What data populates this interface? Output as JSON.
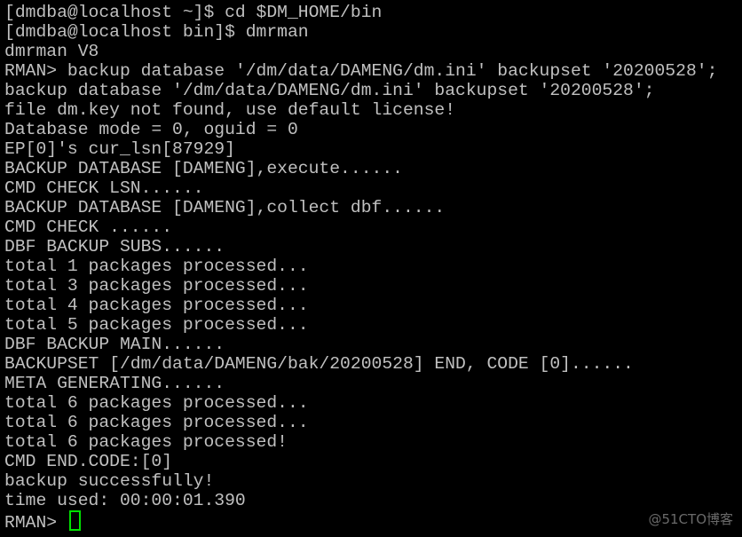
{
  "terminal": {
    "lines": [
      "[dmdba@localhost ~]$ cd $DM_HOME/bin",
      "[dmdba@localhost bin]$ dmrman",
      "dmrman V8",
      "RMAN> backup database '/dm/data/DAMENG/dm.ini' backupset '20200528';",
      "backup database '/dm/data/DAMENG/dm.ini' backupset '20200528';",
      "file dm.key not found, use default license!",
      "Database mode = 0, oguid = 0",
      "EP[0]'s cur_lsn[87929]",
      "BACKUP DATABASE [DAMENG],execute......",
      "CMD CHECK LSN......",
      "BACKUP DATABASE [DAMENG],collect dbf......",
      "CMD CHECK ......",
      "DBF BACKUP SUBS......",
      "total 1 packages processed...",
      "total 3 packages processed...",
      "total 4 packages processed...",
      "total 5 packages processed...",
      "DBF BACKUP MAIN......",
      "BACKUPSET [/dm/data/DAMENG/bak/20200528] END, CODE [0]......",
      "META GENERATING......",
      "total 6 packages processed...",
      "total 6 packages processed...",
      "total 6 packages processed!",
      "CMD END.CODE:[0]",
      "backup successfully!",
      "time used: 00:00:01.390"
    ],
    "prompt": "RMAN> ",
    "cursor_color": "#00e000",
    "text_color": "#c0c0c0",
    "background": "#000000"
  },
  "watermark": "@51CTO博客"
}
